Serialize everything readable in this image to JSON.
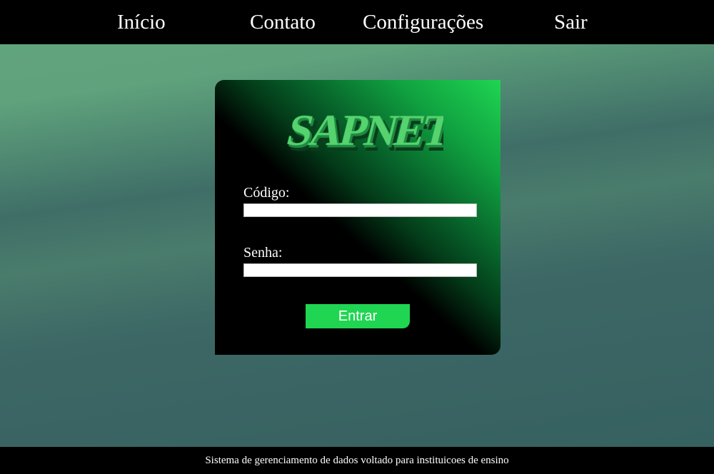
{
  "nav": {
    "items": [
      {
        "label": "Início"
      },
      {
        "label": "Contato"
      },
      {
        "label": "Configurações"
      },
      {
        "label": "Sair"
      }
    ]
  },
  "login": {
    "logo_text": "SAPNET",
    "code_label": "Código:",
    "code_value": "",
    "password_label": "Senha:",
    "password_value": "",
    "submit_label": "Entrar"
  },
  "footer": {
    "text": "Sistema de gerenciamento de dados voltado para instituicoes de ensino"
  },
  "colors": {
    "accent": "#1fd552",
    "bar": "#000000",
    "background_top": "#62a57e",
    "background_bottom": "#356060"
  }
}
